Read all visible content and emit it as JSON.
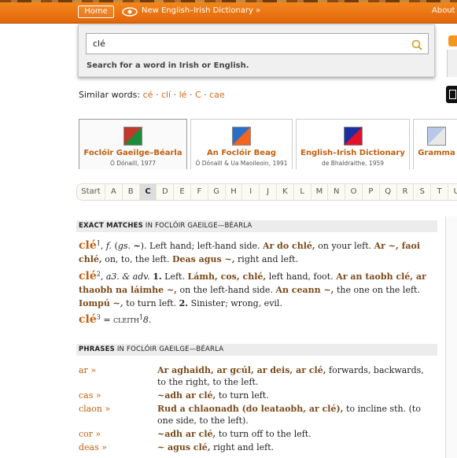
{
  "topbar": {
    "home": "Home",
    "crumb": "New English–Irish Dictionary »",
    "about": "About"
  },
  "search": {
    "value": "clé",
    "hint": "Search for a word in Irish or English."
  },
  "similar": {
    "label": "Similar words:",
    "words": [
      "cé",
      "clí",
      "lé",
      "C",
      "cae"
    ]
  },
  "dicts": [
    {
      "name": "Foclóir Gaeilge–Béarla",
      "sub": "Ó Dónaill, 1977",
      "flag": [
        "#c0392b",
        "#1e8a3c"
      ]
    },
    {
      "name": "An Foclóir Beag",
      "sub": "Ó Dónaill & Ua Maoileoin, 1991",
      "flag": [
        "#2a6ec8",
        "#f5641f"
      ]
    },
    {
      "name": "English–Irish Dictionary",
      "sub": "de Bhaldraithe, 1959",
      "flag": [
        "#1b2fa0",
        "#e3102a"
      ]
    },
    {
      "name": "Gramma",
      "sub": "",
      "flag": [
        "#b8c8e8",
        "#f0f0f0"
      ]
    }
  ],
  "alphabet": {
    "start": "Start",
    "letters": [
      "A",
      "B",
      "C",
      "D",
      "E",
      "F",
      "G",
      "H",
      "I",
      "J",
      "K",
      "L",
      "M",
      "N",
      "O",
      "P",
      "Q",
      "R",
      "S",
      "T",
      "U"
    ],
    "selected": "C"
  },
  "exact": {
    "bold": "EXACT MATCHES",
    "rest": " IN FOCLÓIR GAEILGE—BÉARLA"
  },
  "phrasesHead": {
    "bold": "PHRASES",
    "rest": " IN FOCLÓIR GAEILGE—BÉARLA"
  },
  "entries": {
    "e1": {
      "hw": "clé",
      "num": "1"
    },
    "e2": {
      "hw": "clé",
      "num": "2"
    },
    "e3": {
      "hw": "clé",
      "num": "3"
    }
  },
  "phrases": [
    {
      "key": "ar »"
    },
    {
      "key": "cas »"
    },
    {
      "key": "claon »"
    },
    {
      "key": "cor »"
    },
    {
      "key": "deas »"
    }
  ],
  "colors": {
    "accent": "#c06010",
    "topbar": "#e87a16"
  }
}
